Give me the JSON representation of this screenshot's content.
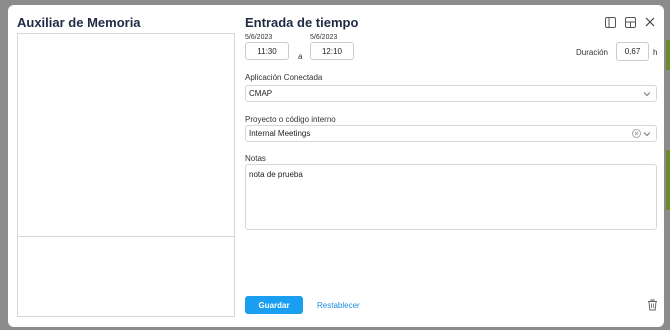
{
  "left_panel": {
    "title": "Auxiliar de Memoria"
  },
  "time_entry": {
    "title": "Entrada de tiempo",
    "start_date": "5/6/2023",
    "start_time": "11:30",
    "separator": "a",
    "end_date": "5/6/2023",
    "end_time": "12:10",
    "duration_label": "Duración",
    "duration_value": "0,67",
    "duration_unit": "h"
  },
  "connected_app": {
    "label": "Aplicación Conectada",
    "value": "CMAP"
  },
  "project": {
    "label": "Proyecto o código interno",
    "value": "Internal Meetings"
  },
  "notes": {
    "label": "Notas",
    "value": "nota de prueba"
  },
  "actions": {
    "save_label": "Guardar",
    "reset_label": "Restablecer"
  },
  "icons": [
    "panel-left-icon",
    "layout-icon",
    "close-icon",
    "chevron-down-icon",
    "clear-icon",
    "trash-icon"
  ],
  "colors": {
    "primary": "#1a9ef0",
    "link": "#1a8ee0",
    "title": "#1f2a44"
  }
}
